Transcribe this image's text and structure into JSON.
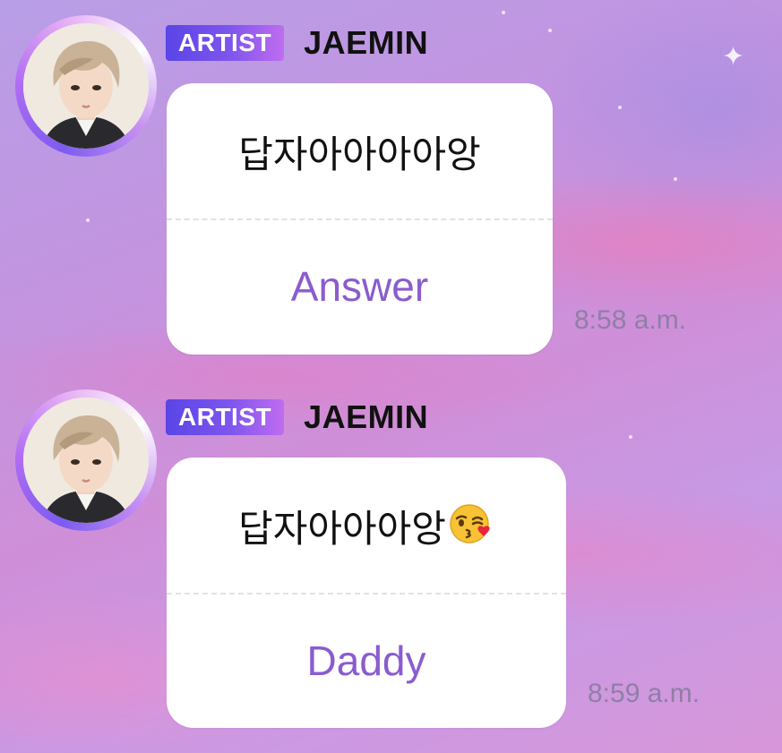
{
  "theme": {
    "accent": "#8a5ccf",
    "badge_gradient_start": "#5a45e6",
    "badge_gradient_end": "#c06cf0",
    "bubble_background": "#ffffff"
  },
  "messages": [
    {
      "badge": "ARTIST",
      "sender": "JAEMIN",
      "avatar_icon": "profile-photo",
      "text": "답자아아아아앙",
      "emoji": "",
      "reply_label": "Answer",
      "time": "8:58 a.m."
    },
    {
      "badge": "ARTIST",
      "sender": "JAEMIN",
      "avatar_icon": "profile-photo",
      "text": "답자아아아앙",
      "emoji": "face-blowing-a-kiss",
      "reply_label": "Daddy",
      "time": "8:59 a.m."
    }
  ]
}
